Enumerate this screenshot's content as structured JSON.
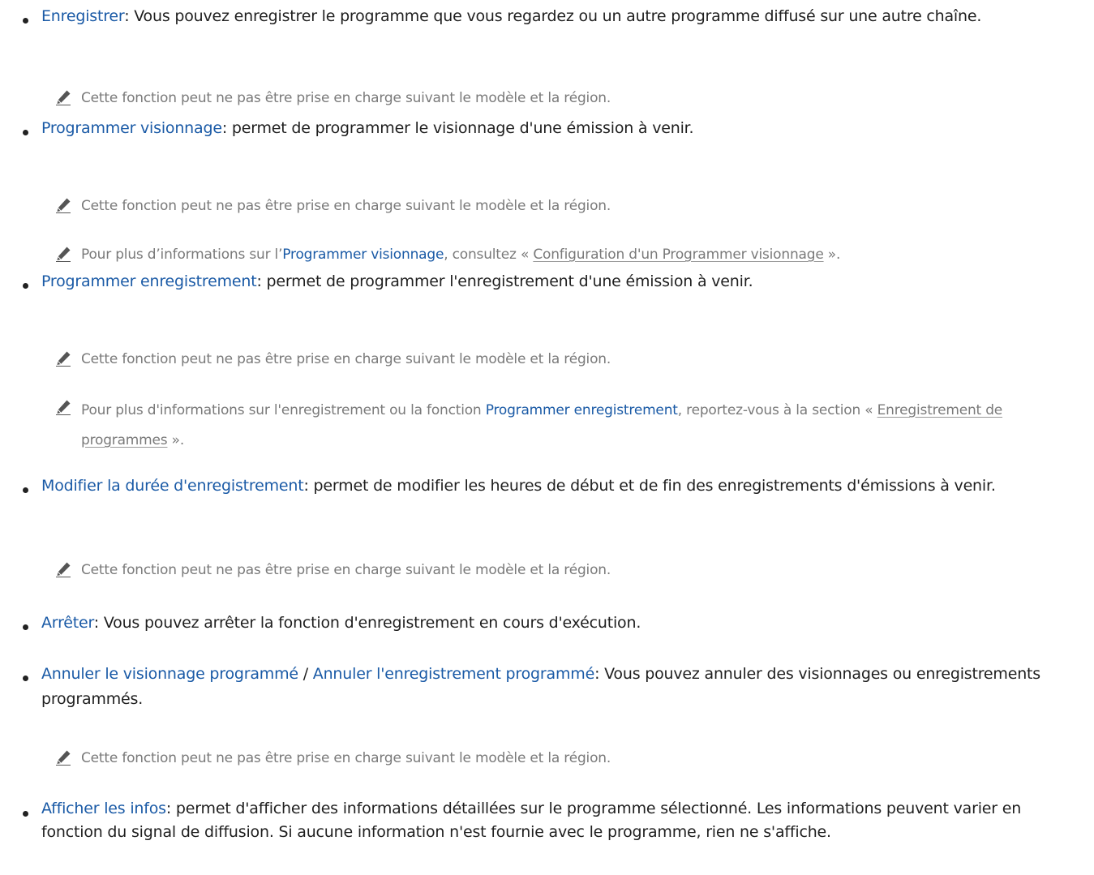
{
  "items": [
    {
      "keyword": "Enregistrer",
      "text": ": Vous pouvez enregistrer le programme que vous regardez ou un autre programme diffusé sur une autre chaîne."
    },
    {
      "note": "Cette fonction peut ne pas être prise en charge suivant le modèle et la région."
    },
    {
      "keyword": "Programmer visionnage",
      "text": ": permet de programmer le visionnage d'une émission à venir."
    },
    {
      "note": "Cette fonction peut ne pas être prise en charge suivant le modèle et la région."
    },
    {
      "note_pre": "Pour plus d’informations sur l’",
      "note_kw": "Programmer visionnage",
      "note_mid": ", consultez « ",
      "note_link": "Configuration d'un Programmer visionnage",
      "note_post": " »."
    },
    {
      "keyword": "Programmer enregistrement",
      "text": ": permet de programmer l'enregistrement d'une émission à venir."
    },
    {
      "note": "Cette fonction peut ne pas être prise en charge suivant le modèle et la région."
    },
    {
      "note_pre": "Pour plus d'informations sur l'enregistrement ou la fonction ",
      "note_kw": "Programmer enregistrement",
      "note_mid": ", reportez-vous à la section « ",
      "note_link": "Enregistrement de programmes",
      "note_post": " »."
    },
    {
      "keyword": "Modifier la durée d'enregistrement",
      "text": ": permet de modifier les heures de début et de fin des enregistrements d'émissions à venir."
    },
    {
      "note": "Cette fonction peut ne pas être prise en charge suivant le modèle et la région."
    },
    {
      "keyword": "Arrêter",
      "text": ": Vous pouvez arrêter la fonction d'enregistrement en cours d'exécution."
    },
    {
      "keyword": "Annuler le visionnage programmé",
      "sep": " / ",
      "keyword2": "Annuler l'enregistrement programmé",
      "text": ": Vous pouvez annuler des visionnages ou enregistrements programmés."
    },
    {
      "note": "Cette fonction peut ne pas être prise en charge suivant le modèle et la région."
    },
    {
      "keyword": "Afficher les infos",
      "text": ": permet d'afficher des informations détaillées sur le programme sélectionné. Les informations peuvent varier en fonction du signal de diffusion. Si aucune information n'est fournie avec le programme, rien ne s'affiche."
    }
  ]
}
